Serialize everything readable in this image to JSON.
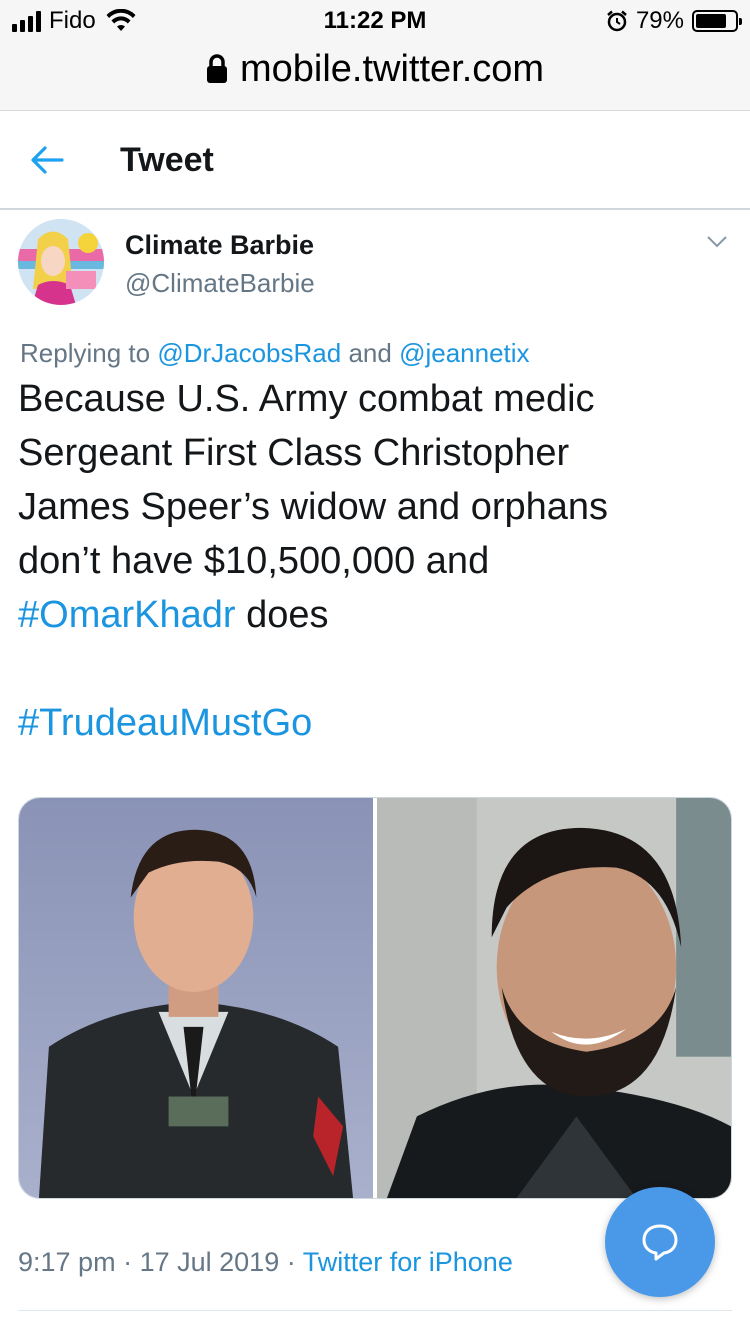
{
  "status_bar": {
    "carrier": "Fido",
    "time": "11:22 PM",
    "battery_percent": "79%",
    "battery_level": 0.79
  },
  "url_bar": {
    "url": "mobile.twitter.com"
  },
  "header": {
    "title": "Tweet"
  },
  "tweet": {
    "author_name": "Climate Barbie",
    "author_handle": "@ClimateBarbie",
    "replying_prefix": "Replying to",
    "reply_mention_1": "@DrJacobsRad",
    "reply_and": "and",
    "reply_mention_2": "@jeannetix",
    "text_line_1": "Because U.S. Army combat medic",
    "text_line_2": "Sergeant First Class Christopher",
    "text_line_3": "James Speer’s widow and orphans",
    "text_line_4": "don’t have $10,500,000 and",
    "hashtag_1": "#OmarKhadr",
    "text_line_5_rest": " does",
    "hashtag_2": "#TrudeauMustGo",
    "time": "9:17 pm",
    "separator": "·",
    "date": "17 Jul 2019",
    "source": "Twitter for iPhone"
  },
  "colors": {
    "link": "#1b95e0",
    "secondary_text": "#657786",
    "fab": "#4a99e9"
  },
  "icons": [
    "back-arrow-icon",
    "chevron-down-icon",
    "lock-icon",
    "wifi-icon",
    "alarm-icon",
    "compose-reply-icon"
  ]
}
